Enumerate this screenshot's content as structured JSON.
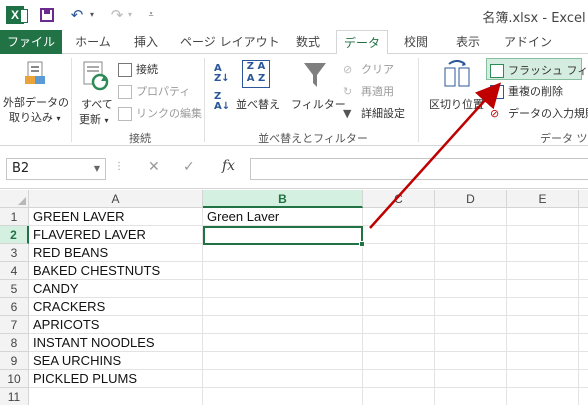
{
  "title_bar": {
    "app_logo": "X",
    "app_title": "名簿.xlsx - Excel"
  },
  "tabs": [
    {
      "label": "ファイル"
    },
    {
      "label": "ホーム"
    },
    {
      "label": "挿入"
    },
    {
      "label": "ページ レイアウト"
    },
    {
      "label": "数式"
    },
    {
      "label": "データ"
    },
    {
      "label": "校閲"
    },
    {
      "label": "表示"
    },
    {
      "label": "アドイン"
    }
  ],
  "ribbon": {
    "external_data": {
      "line1": "外部データの",
      "line2": "取り込み"
    },
    "refresh_all": {
      "line1": "すべて",
      "line2": "更新"
    },
    "connections_btn": "接続",
    "properties_btn": "プロパティ",
    "edit_links_btn": "リンクの編集",
    "connections_group": "接続",
    "sort_btn": "並べ替え",
    "filter_btn": "フィルター",
    "clear_btn": "クリア",
    "reapply_btn": "再適用",
    "advanced_btn": "詳細設定",
    "sort_filter_group": "並べ替えとフィルター",
    "text_to_columns_btn": "区切り位置",
    "flash_fill_btn": "フラッシュ フィル",
    "remove_duplicates_btn": "重複の削除",
    "data_validation_btn": "データの入力規則",
    "data_tools_group": "データ ツ"
  },
  "formula_bar": {
    "name_box": "B2",
    "fx": "fx",
    "formula_value": ""
  },
  "grid": {
    "columns": [
      "A",
      "B",
      "C",
      "D",
      "E"
    ],
    "rows": [
      {
        "n": "1",
        "a": "GREEN LAVER",
        "b": "Green Laver"
      },
      {
        "n": "2",
        "a": "FLAVERED LAVER",
        "b": ""
      },
      {
        "n": "3",
        "a": "RED BEANS",
        "b": ""
      },
      {
        "n": "4",
        "a": "BAKED CHESTNUTS",
        "b": ""
      },
      {
        "n": "5",
        "a": "CANDY",
        "b": ""
      },
      {
        "n": "6",
        "a": "CRACKERS",
        "b": ""
      },
      {
        "n": "7",
        "a": "APRICOTS",
        "b": ""
      },
      {
        "n": "8",
        "a": "INSTANT NOODLES",
        "b": ""
      },
      {
        "n": "9",
        "a": "SEA URCHINS",
        "b": ""
      },
      {
        "n": "10",
        "a": "PICKLED PLUMS",
        "b": ""
      },
      {
        "n": "11",
        "a": "",
        "b": ""
      }
    ],
    "selected_cell": "B2"
  },
  "colors": {
    "brand_green": "#217346",
    "annotation_arrow": "#c00000"
  }
}
